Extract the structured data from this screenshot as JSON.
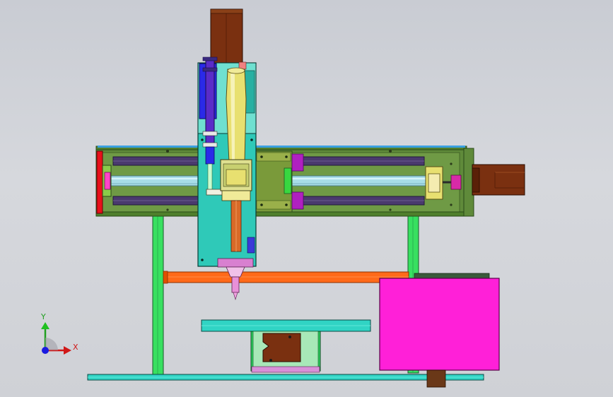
{
  "axis_triad": {
    "x_label": "X",
    "y_label": "Y"
  },
  "colors": {
    "background": "#cfd1d6",
    "gantry_frame": "#5f8a3a",
    "gantry_deck": "#6f9a45",
    "linear_rail": "#4a3a6e",
    "ball_screw": "#a8dde8",
    "carriage_plate": "#2fc9b8",
    "servo_motor": "#7a3010",
    "cylinder": "#5a2cc8",
    "spindle": "#e8e070",
    "support_column": "#38e060",
    "cross_bar": "#ff6a1a",
    "worktable": "#30d4c4",
    "base_plate": "#30d4c4",
    "control_cabinet": "#ff20d8",
    "end_plate": "#e8101a",
    "stop_block": "#b020c0"
  },
  "parts": [
    "top-servo-motor",
    "vertical-carriage",
    "z-cylinder",
    "spindle-motor",
    "gantry-beam",
    "left-end-plate",
    "right-servo-motor",
    "linear-rail-upper",
    "linear-rail-lower",
    "ball-screw",
    "slide-block",
    "left-support-column",
    "right-support-column",
    "cross-bar",
    "nozzle-tool",
    "worktable",
    "lower-motor-mount",
    "base-plate",
    "control-cabinet"
  ]
}
